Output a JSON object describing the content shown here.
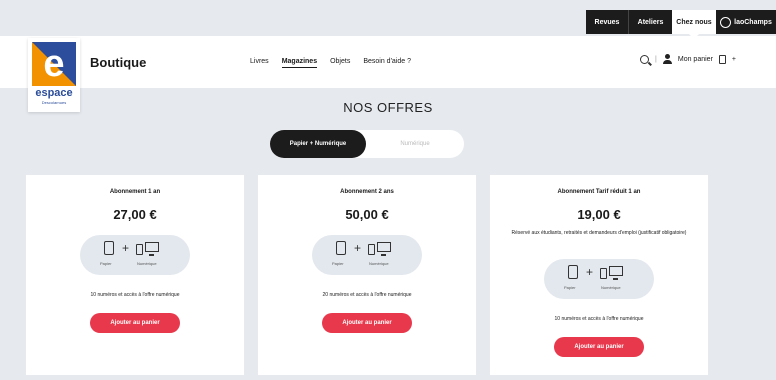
{
  "topbar": {
    "items": [
      "Revues",
      "Ateliers",
      "Chez nous"
    ],
    "power_label": "laoChamps"
  },
  "logo": {
    "letter": "e",
    "word": "espace",
    "subtitle": "Descolarnues"
  },
  "header": {
    "brand": "Boutique",
    "nav": [
      "Livres",
      "Magazines",
      "Objets",
      "Besoin d'aide ?"
    ],
    "active_nav": "Magazines",
    "separator": "|",
    "cart_label": "Mon panier",
    "cart_count": "+"
  },
  "section": {
    "title": "NOS OFFRES",
    "toggle_active": "Papier + Numérique",
    "toggle_inactive": "Numérique"
  },
  "device_labels": {
    "paper": "Papier",
    "digital": "Numérique",
    "plus": "+"
  },
  "cards": [
    {
      "title": "Abonnement 1 an",
      "price": "27,00 €",
      "note": "",
      "desc": "10 numéros et accès à l'offre numérique",
      "button": "Ajouter au panier"
    },
    {
      "title": "Abonnement 2 ans",
      "price": "50,00 €",
      "note": "",
      "desc": "20 numéros et accès à l'offre numérique",
      "button": "Ajouter au panier"
    },
    {
      "title": "Abonnement Tarif réduit 1 an",
      "price": "19,00 €",
      "note": "Réservé aux étudiants, retraités et demandeurs d'emploi (justificatif obligatoire)",
      "desc": "10 numéros et accès à l'offre numérique",
      "button": "Ajouter au panier"
    }
  ],
  "colors": {
    "background": "#e6eaef",
    "brand_blue": "#2b4d9b",
    "brand_orange": "#f39200",
    "button_red": "#e8384b",
    "toggle_dark": "#1c1c1c"
  },
  "icons": [
    "search-icon",
    "user-icon",
    "cart-icon",
    "power-icon",
    "tablet-icon",
    "phone-icon",
    "monitor-icon"
  ]
}
